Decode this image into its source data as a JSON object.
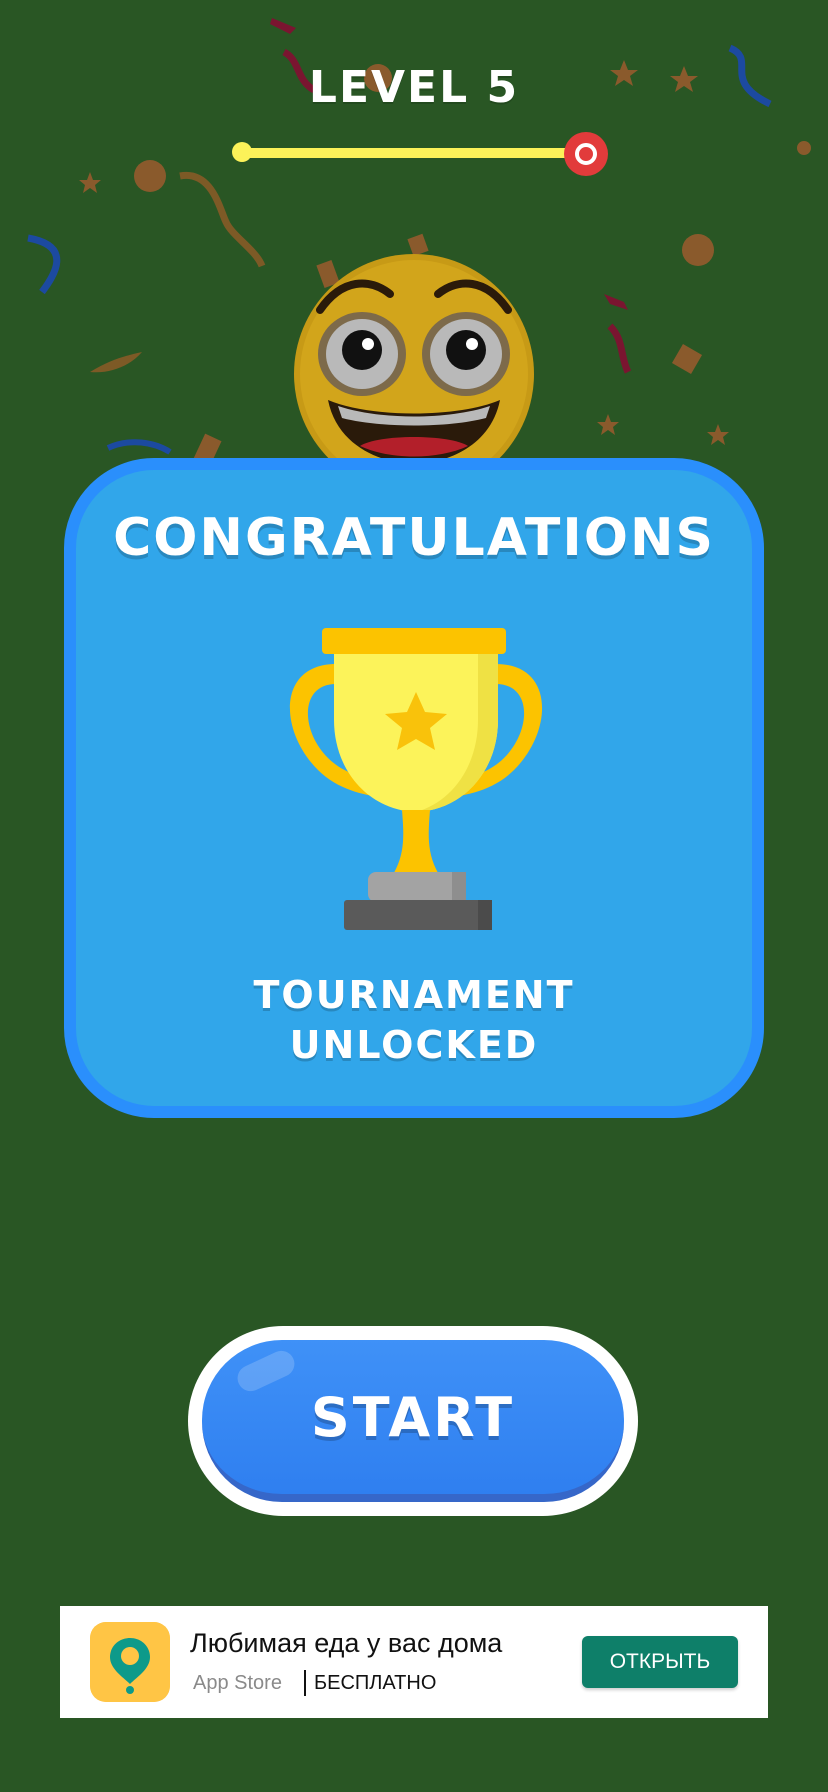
{
  "level": {
    "title": "LEVEL 5",
    "progress": 1.0
  },
  "popup": {
    "title": "CONGRATULATIONS",
    "subtitle_line1": "TOURNAMENT",
    "subtitle_line2": "UNLOCKED",
    "icon": "trophy-icon"
  },
  "actions": {
    "start_label": "START"
  },
  "ad": {
    "icon": "map-pin-icon",
    "title": "Любимая еда у вас дома",
    "store": "App Store",
    "price": "БЕСПЛАТНО",
    "button_label": "ОТКРЫТЬ"
  },
  "colors": {
    "background": "#295624",
    "card": "#31a6ea",
    "card_border": "#2a8ffc",
    "progress": "#fcf259",
    "progress_end": "#e23b3b",
    "start_button": "#2f7ff0",
    "ad_button": "#0e7f69"
  }
}
